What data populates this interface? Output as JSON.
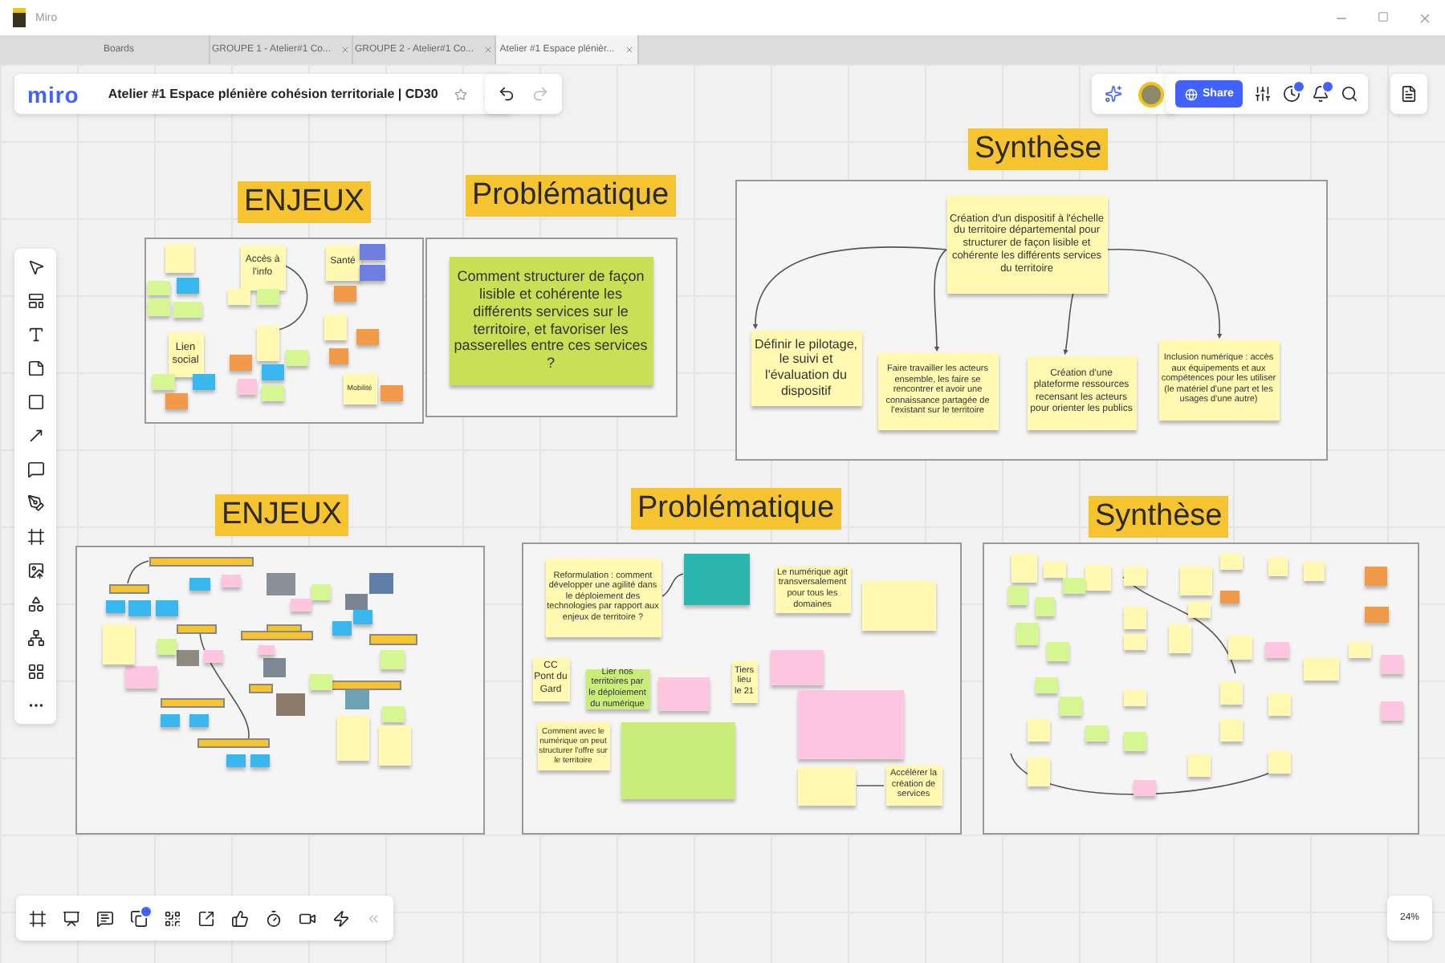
{
  "window": {
    "title": "Miro"
  },
  "tabs": [
    {
      "label": "Boards",
      "selected": false,
      "closable": false
    },
    {
      "label": "GROUPE 1 - Atelier#1 Co...",
      "selected": false,
      "closable": true
    },
    {
      "label": "GROUPE 2 - Atelier#1 Co...",
      "selected": false,
      "closable": true
    },
    {
      "label": "Atelier #1 Espace plénièr...",
      "selected": true,
      "closable": true
    }
  ],
  "toolbar": {
    "logo": "miro",
    "board_title": "Atelier #1 Espace plénière cohésion territoriale | CD30",
    "share": "Share"
  },
  "frames": [
    {
      "title": "ENJEUX",
      "notes": [
        {
          "color": "#fff9b1"
        },
        {
          "text": "Accès à l'info",
          "color": "#fff9b1"
        },
        {
          "text": "Santé",
          "color": "#fff9b1"
        },
        {
          "color": "#6e7fe0"
        },
        {
          "color": "#6e7fe0"
        },
        {
          "color": "#d5f692"
        },
        {
          "color": "#39b8f0"
        },
        {
          "color": "#d5f692"
        },
        {
          "color": "#d5f692"
        },
        {
          "text": "Lien social",
          "color": "#fff9b1"
        },
        {
          "color": "#fff9b1"
        },
        {
          "color": "#d5f692"
        },
        {
          "color": "#f09a4a"
        },
        {
          "color": "#fff9b1"
        },
        {
          "color": "#f09a4a"
        },
        {
          "color": "#d5f692"
        },
        {
          "color": "#39b8f0"
        },
        {
          "color": "#ffc6e0"
        },
        {
          "color": "#d5f692"
        },
        {
          "color": "#d5f692"
        },
        {
          "color": "#39b8f0"
        },
        {
          "color": "#f09a4a"
        },
        {
          "color": "#fff9b1"
        },
        {
          "color": "#f09a4a"
        },
        {
          "color": "#f09a4a"
        },
        {
          "text": "Mobilité",
          "color": "#fff9b1"
        },
        {
          "color": "#f09a4a"
        }
      ]
    },
    {
      "title": "Problématique",
      "notes": [
        {
          "text": "Comment structurer de façon lisible et cohérente les différents services sur le territoire, et favoriser les passerelles entre ces services ?",
          "color": "#c9df56"
        }
      ]
    },
    {
      "title": "Synthèse",
      "notes": [
        {
          "text": "Création d'un dispositif à l'échelle du territoire départemental pour structurer de façon lisible et cohérente les différents services du territoire",
          "color": "#fff9b1"
        },
        {
          "text": "Définir le pilotage, le suivi et l'évaluation du dispositif",
          "color": "#fff9b1"
        },
        {
          "text": "Faire travailler les acteurs ensemble, les faire se rencontrer et avoir une connaissance partagée de l'existant sur le territoire",
          "color": "#fff9b1"
        },
        {
          "text": "Création d'une plateforme ressources recensant les acteurs pour orienter les publics",
          "color": "#fff9b1"
        },
        {
          "text": "Inclusion numérique : accès aux équipements et aux compétences pour les utiliser (le matériel d'une part et les usages d'une autre)",
          "color": "#fff9b1"
        }
      ]
    },
    {
      "title": "ENJEUX",
      "notes": [
        {
          "kind": "label",
          "color": "#f6c431"
        },
        {
          "kind": "label",
          "color": "#f6c431"
        },
        {
          "kind": "label",
          "color": "#f6c431"
        },
        {
          "kind": "label",
          "color": "#f6c431"
        },
        {
          "kind": "label",
          "color": "#f6c431"
        },
        {
          "kind": "label",
          "color": "#f6c431"
        },
        {
          "kind": "label",
          "color": "#f6c431"
        },
        {
          "kind": "label",
          "color": "#f6c431"
        },
        {
          "kind": "label",
          "color": "#f6c431"
        },
        {
          "kind": "label",
          "color": "#f6c431"
        },
        {
          "kind": "photo",
          "color": "#8a8f99"
        },
        {
          "kind": "photo",
          "color": "#5f7fa8"
        },
        {
          "kind": "photo",
          "color": "#7c8594"
        },
        {
          "kind": "photo",
          "color": "#8f8a80"
        },
        {
          "kind": "photo",
          "color": "#7d8a96"
        },
        {
          "kind": "photo",
          "color": "#8c7b6b"
        },
        {
          "kind": "photo",
          "color": "#6ea2b5"
        },
        {
          "kind": "note",
          "color": "#39b8f0"
        },
        {
          "kind": "note",
          "color": "#39b8f0"
        },
        {
          "kind": "note",
          "color": "#39b8f0"
        },
        {
          "kind": "note",
          "color": "#39b8f0"
        },
        {
          "kind": "note",
          "color": "#39b8f0"
        },
        {
          "kind": "note",
          "color": "#39b8f0"
        },
        {
          "kind": "note",
          "color": "#39b8f0"
        },
        {
          "kind": "note",
          "color": "#39b8f0"
        },
        {
          "kind": "note",
          "color": "#39b8f0"
        },
        {
          "kind": "note",
          "color": "#39b8f0"
        },
        {
          "kind": "note",
          "color": "#d5f692"
        },
        {
          "kind": "note",
          "color": "#d5f692"
        },
        {
          "kind": "note",
          "color": "#d5f692"
        },
        {
          "kind": "note",
          "color": "#d5f692"
        },
        {
          "kind": "note",
          "color": "#d5f692"
        },
        {
          "kind": "note",
          "color": "#ffc6e0"
        },
        {
          "kind": "note",
          "color": "#ffc6e0"
        },
        {
          "kind": "note",
          "color": "#ffc6e0"
        },
        {
          "kind": "note",
          "color": "#ffc6e0"
        },
        {
          "kind": "note",
          "color": "#ffc6e0"
        },
        {
          "kind": "note",
          "color": "#fff9b1"
        },
        {
          "kind": "note",
          "color": "#fff9b1"
        },
        {
          "kind": "note",
          "color": "#fff9b1"
        }
      ]
    },
    {
      "title": "Problématique",
      "notes": [
        {
          "text": "Reformulation : comment développer une agilité dans le déploiement des technologies par rapport aux enjeux de territoire ?",
          "color": "#fff9b1"
        },
        {
          "color": "#2bb7b0"
        },
        {
          "text": "Le numérique agit transversalement pour tous les domaines",
          "color": "#fff9b1"
        },
        {
          "color": "#fff9b1"
        },
        {
          "text": "CC Pont du Gard",
          "color": "#fff9b1"
        },
        {
          "text": "Lier nos territoires par le déploiement du numérique",
          "color": "#c9ec7a"
        },
        {
          "color": "#ffc6e0"
        },
        {
          "text": "Tiers lieu le 21",
          "color": "#fff9b1"
        },
        {
          "color": "#ffc6e0"
        },
        {
          "color": "#ffc6e0"
        },
        {
          "text": "Comment avec le numérique on peut structurer l'offre sur le territoire",
          "color": "#fff9b1"
        },
        {
          "color": "#c9ec7a"
        },
        {
          "color": "#fff9b1"
        },
        {
          "text": "Accélérer la création de services",
          "color": "#fff9b1"
        }
      ]
    },
    {
      "title": "Synthèse",
      "notes": [
        {
          "color": "#fff9b1"
        },
        {
          "color": "#fff9b1"
        },
        {
          "color": "#fff9b1"
        },
        {
          "color": "#fff9b1"
        },
        {
          "color": "#fff9b1"
        },
        {
          "color": "#fff9b1"
        },
        {
          "color": "#fff9b1"
        },
        {
          "color": "#fff9b1"
        },
        {
          "color": "#fff9b1"
        },
        {
          "color": "#fff9b1"
        },
        {
          "color": "#fff9b1"
        },
        {
          "color": "#fff9b1"
        },
        {
          "color": "#fff9b1"
        },
        {
          "color": "#fff9b1"
        },
        {
          "color": "#fff9b1"
        },
        {
          "color": "#fff9b1"
        },
        {
          "color": "#fff9b1"
        },
        {
          "color": "#fff9b1"
        },
        {
          "color": "#fff9b1"
        },
        {
          "color": "#d5f692"
        },
        {
          "color": "#d5f692"
        },
        {
          "color": "#d5f692"
        },
        {
          "color": "#d5f692"
        },
        {
          "color": "#d5f692"
        },
        {
          "color": "#d5f692"
        },
        {
          "color": "#d5f692"
        },
        {
          "color": "#d5f692"
        },
        {
          "color": "#d5f692"
        },
        {
          "color": "#f09a4a"
        },
        {
          "color": "#f09a4a"
        },
        {
          "color": "#f09a4a"
        },
        {
          "color": "#ffc6e0"
        },
        {
          "color": "#ffc6e0"
        },
        {
          "color": "#ffc6e0"
        },
        {
          "color": "#ffc6e0"
        },
        {
          "color": "#fff9b1"
        },
        {
          "color": "#fff9b1"
        },
        {
          "color": "#fff9b1"
        },
        {
          "color": "#fff9b1"
        }
      ]
    }
  ],
  "zoom": "24%"
}
